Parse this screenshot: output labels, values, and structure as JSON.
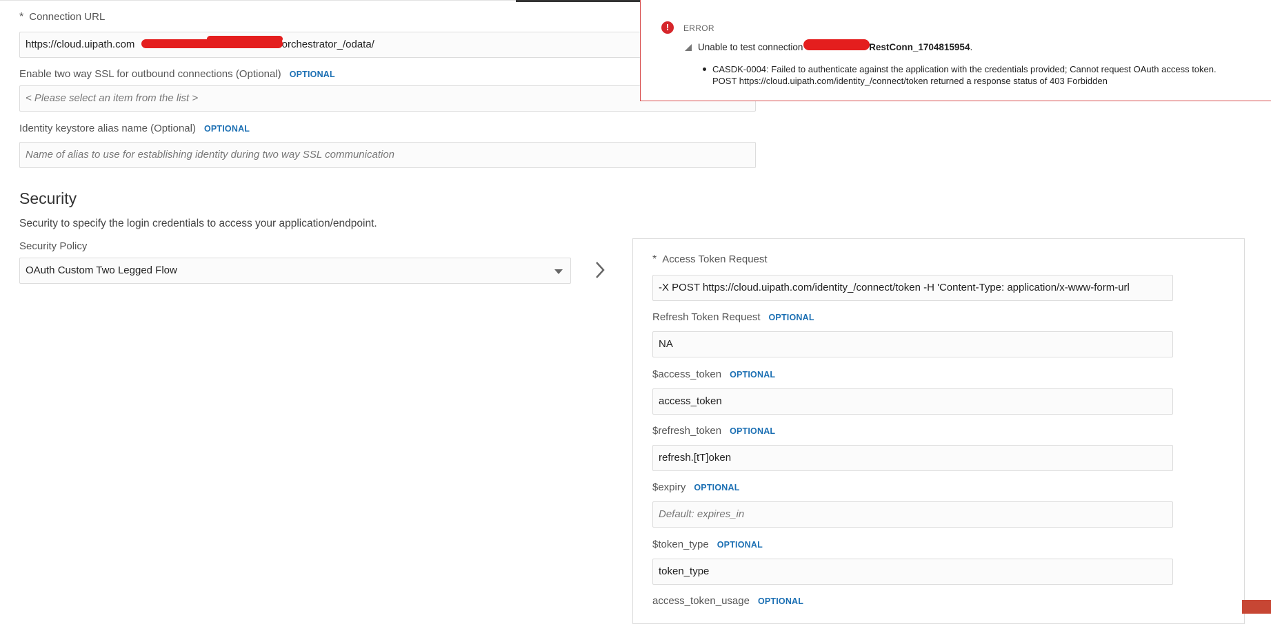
{
  "connection": {
    "url_label": "Connection URL",
    "url_value_prefix": "https://cloud.uipath.com",
    "url_value_suffix": "/orchestrator_/odata/",
    "ssl_label": "Enable two way SSL for outbound connections (Optional)",
    "ssl_placeholder": "< Please select an item from the list >",
    "alias_label": "Identity keystore alias name (Optional)",
    "alias_placeholder": "Name of alias to use for establishing identity during two way SSL communication",
    "optional": "OPTIONAL"
  },
  "security": {
    "title": "Security",
    "description": "Security to specify the login credentials to access your application/endpoint.",
    "policy_label": "Security Policy",
    "policy_value": "OAuth Custom Two Legged Flow"
  },
  "oauth": {
    "access_token_request_label": "Access Token Request",
    "access_token_request_value": "-X POST https://cloud.uipath.com/identity_/connect/token -H 'Content-Type: application/x-www-form-url",
    "refresh_token_request_label": "Refresh Token Request",
    "refresh_token_request_value": "NA",
    "access_token_label": "$access_token",
    "access_token_value": "access_token",
    "refresh_token_label": "$refresh_token",
    "refresh_token_value": "refresh.[tT]oken",
    "expiry_label": "$expiry",
    "expiry_placeholder": "Default: expires_in",
    "token_type_label": "$token_type",
    "token_type_value": "token_type",
    "access_token_usage_label": "access_token_usage",
    "optional": "OPTIONAL"
  },
  "error": {
    "heading": "ERROR",
    "summary_prefix": "Unable to test connection ",
    "summary_name": "RestConn_1704815954",
    "summary_end": ".",
    "detail_line1": "CASDK-0004: Failed to authenticate against the application with the credentials provided; Cannot request OAuth access token.",
    "detail_line2": "POST https://cloud.uipath.com/identity_/connect/token returned a response status of 403 Forbidden"
  },
  "colors": {
    "optional_blue": "#1b6fb3",
    "error_red": "#d6262b",
    "redaction_red": "#e41e1e"
  }
}
